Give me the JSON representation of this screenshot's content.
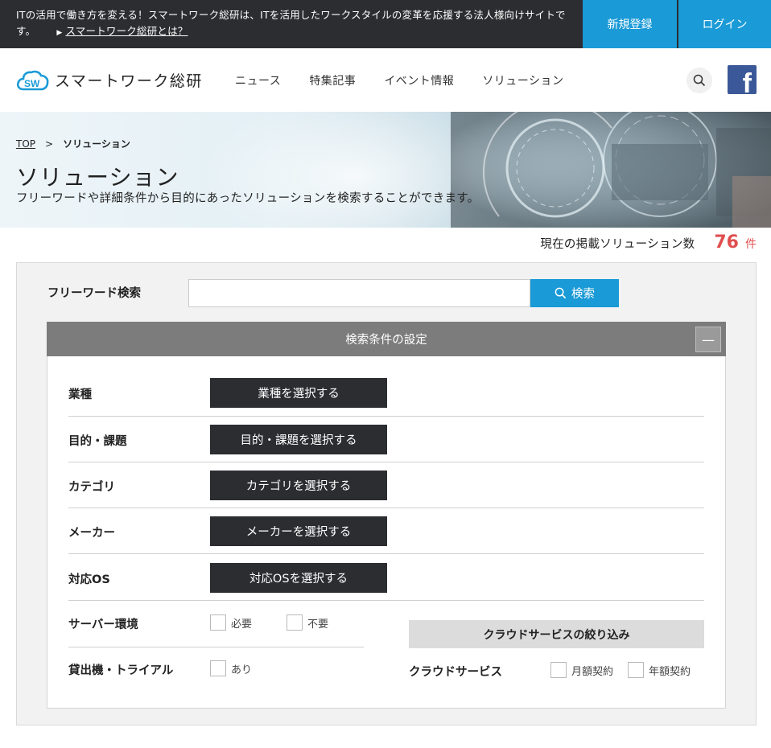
{
  "topbar": {
    "text": "ITの活用で働き方を変える！スマートワーク総研は、ITを活用したワークスタイルの変革を応援する法人様向けサイトです。",
    "link": "スマートワーク総研とは？",
    "signup": "新規登録",
    "login": "ログイン"
  },
  "header": {
    "logo_text": "スマートワーク総研",
    "nav": [
      "ニュース",
      "特集記事",
      "イベント情報",
      "ソリューション"
    ]
  },
  "hero": {
    "breadcrumb_top": "TOP",
    "breadcrumb_sep": ">",
    "breadcrumb_current": "ソリューション",
    "title": "ソリューション",
    "subtitle": "フリーワードや詳細条件から目的にあったソリューションを検索することができます。"
  },
  "count": {
    "label": "現在の掲載ソリューション数",
    "value": "76",
    "unit": "件"
  },
  "search": {
    "label": "フリーワード検索",
    "value": "",
    "placeholder": "",
    "button": "検索"
  },
  "conditions": {
    "title": "検索条件の設定",
    "collapse": "—",
    "rows": [
      {
        "label": "業種",
        "button": "業種を選択する"
      },
      {
        "label": "目的・課題",
        "button": "目的・課題を選択する"
      },
      {
        "label": "カテゴリ",
        "button": "カテゴリを選択する"
      },
      {
        "label": "メーカー",
        "button": "メーカーを選択する"
      },
      {
        "label": "対応OS",
        "button": "対応OSを選択する"
      }
    ],
    "server": {
      "label": "サーバー環境",
      "options": [
        "必要",
        "不要"
      ]
    },
    "trial": {
      "label": "貸出機・トライアル",
      "options": [
        "あり"
      ]
    },
    "cloud": {
      "head": "クラウドサービスの絞り込み",
      "label": "クラウドサービス",
      "options": [
        "月額契約",
        "年額契約"
      ]
    }
  },
  "colors": {
    "accent": "#1a9ad6",
    "dark": "#2b2d31",
    "count": "#e04f4f",
    "facebook": "#3b5998"
  },
  "icons": [
    "cloud-logo-icon",
    "search-icon",
    "facebook-icon"
  ]
}
